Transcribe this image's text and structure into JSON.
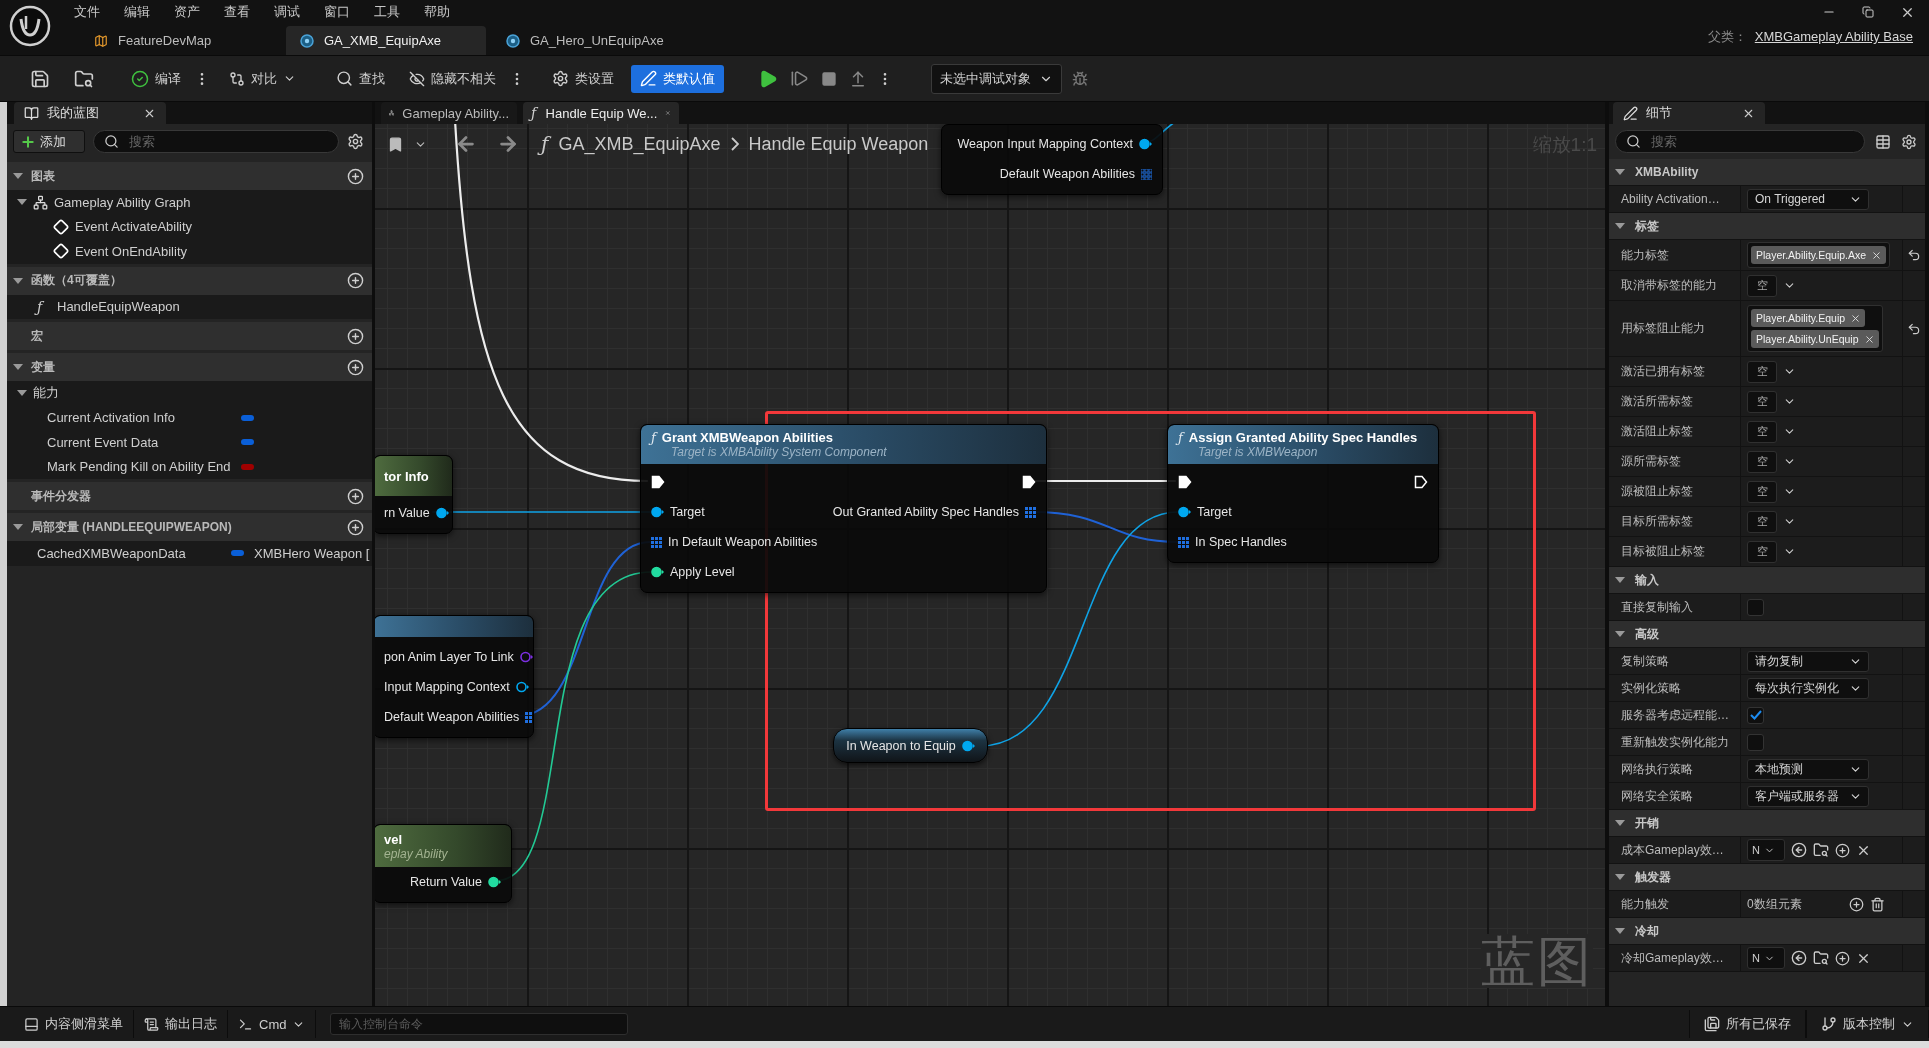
{
  "app": {
    "menu": [
      "文件",
      "编辑",
      "资产",
      "查看",
      "调试",
      "窗口",
      "工具",
      "帮助"
    ],
    "doc_tabs": [
      {
        "label": "FeatureDevMap",
        "kind": "map",
        "selected": false
      },
      {
        "label": "GA_XMB_EquipAxe",
        "kind": "blueprint",
        "selected": true
      },
      {
        "label": "GA_Hero_UnEquipAxe",
        "kind": "blueprint",
        "selected": false
      }
    ],
    "parent_class": {
      "label": "父类：",
      "value": "XMBGameplay Ability Base"
    }
  },
  "toolbar": {
    "items": [
      {
        "kind": "save"
      },
      {
        "kind": "browse"
      },
      {
        "kind": "compile",
        "label": "编译"
      },
      {
        "kind": "more"
      },
      {
        "kind": "diff",
        "label": "对比"
      },
      {
        "kind": "find",
        "label": "查找"
      },
      {
        "kind": "hide",
        "label": "隐藏不相关"
      },
      {
        "kind": "more"
      },
      {
        "kind": "class_settings",
        "label": "类设置",
        "active": false
      },
      {
        "kind": "class_defaults",
        "label": "类默认值",
        "active": true
      },
      {
        "kind": "play"
      },
      {
        "kind": "step"
      },
      {
        "kind": "stop"
      },
      {
        "kind": "eject"
      },
      {
        "kind": "more"
      },
      {
        "kind": "debug_select",
        "label": "未选中调试对象"
      },
      {
        "kind": "debug_icon"
      }
    ]
  },
  "my_blueprint": {
    "title": "我的蓝图",
    "add_label": "添加",
    "search_placeholder": "搜索",
    "sections": [
      {
        "title": "图表",
        "expanded": true,
        "items": [
          {
            "label": "Gameplay Ability Graph",
            "kind": "graph",
            "expanded": true,
            "children": [
              {
                "label": "Event ActivateAbility",
                "kind": "event"
              },
              {
                "label": "Event OnEndAbility",
                "kind": "event"
              }
            ]
          }
        ]
      },
      {
        "title": "函数（4可覆盖）",
        "expanded": true,
        "items": [
          {
            "label": "HandleEquipWeapon",
            "kind": "function",
            "icon": "ƒ"
          }
        ]
      },
      {
        "title": "宏"
      },
      {
        "title": "变量",
        "expanded": true,
        "items": [
          {
            "label": "能力",
            "kind": "category",
            "expanded": true,
            "children": [
              {
                "label": "Current Activation Info",
                "kind": "variable",
                "color": "#0a5fd8"
              },
              {
                "label": "Current Event Data",
                "kind": "variable",
                "color": "#0a5fd8"
              },
              {
                "label": "Mark Pending Kill on Ability End",
                "kind": "variable",
                "color": "#a00000"
              }
            ]
          }
        ]
      },
      {
        "title": "事件分发器"
      },
      {
        "title": "局部变量 (HANDLEEQUIPWEAPON)",
        "expanded": true,
        "items": [
          {
            "label": "CachedXMBWeaponData",
            "kind": "variable",
            "color": "#0a5fd8",
            "type": "XMBHero Weapon ["
          }
        ]
      }
    ]
  },
  "graph": {
    "tabs": [
      {
        "label": "Gameplay Ability...",
        "kind": "graph",
        "selected": false
      },
      {
        "label": "Handle Equip We...",
        "kind": "function",
        "icon": "ƒ",
        "selected": true
      }
    ],
    "breadcrumb": {
      "icon": "ƒ",
      "path": [
        "GA_XMB_EquipAxe",
        "Handle Equip Weapon"
      ]
    },
    "zoom": "缩放1:1",
    "nodes": [
      {
        "kind": "partial",
        "rows": [
          {
            "out": {
              "label": "Weapon Input Mapping Context",
              "kind": "object",
              "connected": true
            }
          },
          {
            "out": {
              "label": "Default Weapon Abilities",
              "kind": "array",
              "connected": false
            }
          }
        ]
      },
      {
        "kind": "function",
        "icon": "ƒ",
        "title": "Grant XMBWeapon Abilities",
        "subtitle": "Target is XMBAbility System Component",
        "rows": [
          {
            "in": {
              "kind": "exec",
              "connected": true
            },
            "out": {
              "kind": "exec",
              "connected": true
            }
          },
          {
            "in": {
              "label": "Target",
              "kind": "object",
              "connected": true
            },
            "out": {
              "label": "Out Granted Ability Spec Handles",
              "kind": "array",
              "connected": true
            }
          },
          {
            "in": {
              "label": "In Default Weapon Abilities",
              "kind": "array",
              "connected": true
            }
          },
          {
            "in": {
              "label": "Apply Level",
              "kind": "int",
              "connected": true
            }
          }
        ]
      },
      {
        "kind": "function",
        "icon": "ƒ",
        "title": "Assign Granted Ability Spec Handles",
        "subtitle": "Target is XMBWeapon",
        "rows": [
          {
            "in": {
              "kind": "exec",
              "connected": true
            },
            "out": {
              "kind": "exec",
              "connected": false
            }
          },
          {
            "in": {
              "label": "Target",
              "kind": "object",
              "connected": true
            }
          },
          {
            "in": {
              "label": "In Spec Handles",
              "kind": "array",
              "connected": true
            }
          }
        ]
      },
      {
        "kind": "pure",
        "title": "tor Info",
        "rows": [
          {
            "out": {
              "label": "rn Value",
              "kind": "object",
              "connected": true
            }
          }
        ]
      },
      {
        "kind": "function",
        "rows": [
          {
            "out": {
              "label": "pon Anim Layer To Link",
              "kind": "class",
              "connected": false
            }
          },
          {
            "out": {
              "label": "Input Mapping Context",
              "kind": "object",
              "connected": false
            }
          },
          {
            "out": {
              "label": "Default Weapon Abilities",
              "kind": "array",
              "connected": true
            }
          }
        ]
      },
      {
        "kind": "pure",
        "title": "vel",
        "subtitle": "eplay Ability",
        "rows": [
          {
            "out": {
              "label": "Return Value",
              "kind": "int",
              "connected": true
            }
          }
        ]
      }
    ],
    "variable": {
      "label": "In Weapon to Equip",
      "pin": {
        "kind": "object",
        "connected": true
      }
    },
    "type_label": "蓝图"
  },
  "details": {
    "title": "细节",
    "search_placeholder": "搜索",
    "categories": [
      {
        "title": "XMBAbility",
        "expanded": true,
        "rows": [
          {
            "label": "Ability Activation…",
            "kind": "dropdown",
            "value": "On Triggered"
          }
        ]
      },
      {
        "title": "标签",
        "expanded": true,
        "rows": [
          {
            "label": "能力标签",
            "kind": "tags",
            "tags": [
              "Player.Ability.Equip.Axe"
            ],
            "reset": true
          },
          {
            "label": "取消带标签的能力",
            "kind": "empty_tags",
            "value": "空"
          },
          {
            "label": "用标签阻止能力",
            "kind": "tags",
            "tags": [
              "Player.Ability.Equip",
              "Player.Ability.UnEquip"
            ],
            "reset": true
          },
          {
            "label": "激活已拥有标签",
            "kind": "empty_tags",
            "value": "空"
          },
          {
            "label": "激活所需标签",
            "kind": "empty_tags",
            "value": "空"
          },
          {
            "label": "激活阻止标签",
            "kind": "empty_tags",
            "value": "空"
          },
          {
            "label": "源所需标签",
            "kind": "empty_tags",
            "value": "空"
          },
          {
            "label": "源被阻止标签",
            "kind": "empty_tags",
            "value": "空"
          },
          {
            "label": "目标所需标签",
            "kind": "empty_tags",
            "value": "空"
          },
          {
            "label": "目标被阻止标签",
            "kind": "empty_tags",
            "value": "空"
          }
        ]
      },
      {
        "title": "输入",
        "expanded": true,
        "rows": [
          {
            "label": "直接复制输入",
            "kind": "checkbox",
            "checked": false
          }
        ]
      },
      {
        "title": "高级",
        "expanded": true,
        "rows": [
          {
            "label": "复制策略",
            "kind": "dropdown",
            "value": "请勿复制"
          },
          {
            "label": "实例化策略",
            "kind": "dropdown",
            "value": "每次执行实例化"
          },
          {
            "label": "服务器考虑远程能…",
            "kind": "checkbox",
            "checked": true
          },
          {
            "label": "重新触发实例化能力",
            "kind": "checkbox",
            "checked": false
          },
          {
            "label": "网络执行策略",
            "kind": "dropdown",
            "value": "本地预测"
          },
          {
            "label": "网络安全策略",
            "kind": "dropdown",
            "value": "客户端或服务器"
          }
        ]
      },
      {
        "title": "开销",
        "expanded": true,
        "rows": [
          {
            "label": "成本Gameplay效…",
            "kind": "asset",
            "value": "N"
          }
        ]
      },
      {
        "title": "触发器",
        "expanded": true,
        "rows": [
          {
            "label": "能力触发",
            "kind": "array",
            "value": "0数组元素"
          }
        ]
      },
      {
        "title": "冷却",
        "expanded": true,
        "rows": [
          {
            "label": "冷却Gameplay效…",
            "kind": "asset",
            "value": "N"
          }
        ]
      }
    ]
  },
  "status_bar": {
    "left": [
      {
        "kind": "drawer",
        "label": "内容侧滑菜单"
      },
      {
        "kind": "log",
        "label": "输出日志"
      },
      {
        "kind": "cmd",
        "label": "Cmd"
      }
    ],
    "console_placeholder": "输入控制台命令",
    "right": [
      {
        "kind": "saved",
        "label": "所有已保存"
      },
      {
        "kind": "source_control",
        "label": "版本控制"
      }
    ]
  }
}
